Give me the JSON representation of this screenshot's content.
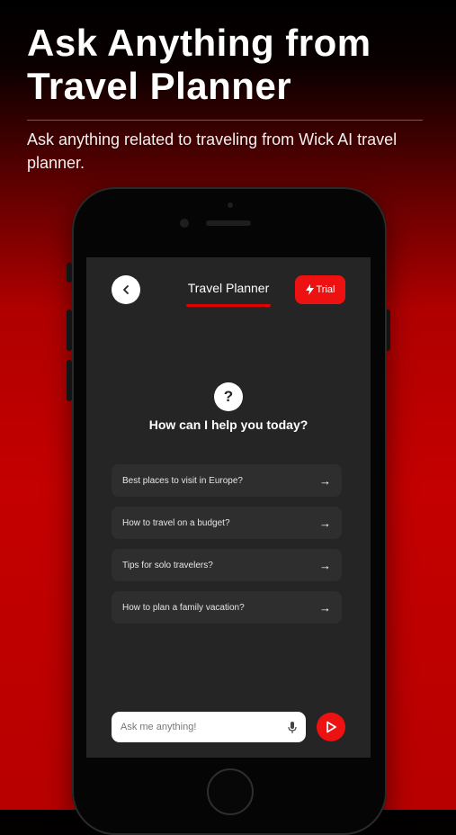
{
  "promo": {
    "headline": "Ask Anything from Travel Planner",
    "subtitle": "Ask anything related to traveling from Wick AI travel planner."
  },
  "app": {
    "title": "Travel Planner",
    "trial_label": "Trial",
    "help_icon_glyph": "?",
    "help_heading": "How can I help you today?",
    "suggestions": [
      {
        "label": "Best places to visit in Europe?",
        "icon": "arrow-right-icon"
      },
      {
        "label": "How to travel on a budget?",
        "icon": "arrow-right-icon"
      },
      {
        "label": "Tips for solo travelers?",
        "icon": "arrow-right-icon"
      },
      {
        "label": "How to plan a family vacation?",
        "icon": "arrow-right-icon"
      }
    ],
    "input_placeholder": "Ask me anything!"
  },
  "colors": {
    "accent_red": "#ee1111",
    "screen_bg": "#252525",
    "card_bg": "#2e2e2e"
  },
  "icons": [
    "chevron-left-icon",
    "bolt-icon",
    "help-icon",
    "arrow-right-icon",
    "microphone-icon",
    "send-icon"
  ]
}
